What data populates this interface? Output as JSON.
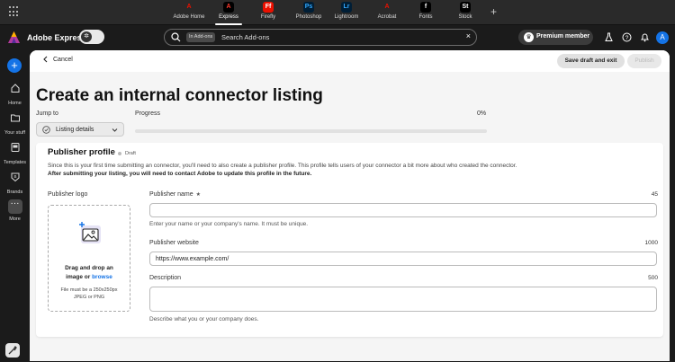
{
  "switcher": {
    "apps": [
      {
        "label": "Adobe Home",
        "glyph": "A",
        "bg": "#2a2a2a",
        "fg": "#eb1000",
        "active": false
      },
      {
        "label": "Express",
        "glyph": "A",
        "bg": "#000000",
        "fg": "#ff3a2e",
        "active": true
      },
      {
        "label": "Firefly",
        "glyph": "Ff",
        "bg": "#eb1000",
        "fg": "#ffffff",
        "active": false
      },
      {
        "label": "Photoshop",
        "glyph": "Ps",
        "bg": "#001e36",
        "fg": "#31a8ff",
        "active": false
      },
      {
        "label": "Lightroom",
        "glyph": "Lr",
        "bg": "#001e36",
        "fg": "#31a8ff",
        "active": false
      },
      {
        "label": "Acrobat",
        "glyph": "A",
        "bg": "#2a2a2a",
        "fg": "#eb1000",
        "active": false
      },
      {
        "label": "Fonts",
        "glyph": "f",
        "bg": "#000000",
        "fg": "#ffffff",
        "active": false
      },
      {
        "label": "Stock",
        "glyph": "St",
        "bg": "#000000",
        "fg": "#ffffff",
        "active": false
      }
    ]
  },
  "topbar": {
    "brand": "Adobe Express",
    "search_chip": "In Add-ons",
    "search_placeholder": "Search Add-ons",
    "premium": "Premium member",
    "avatar": "A"
  },
  "rail": {
    "items": [
      {
        "label": "Home"
      },
      {
        "label": "Your stuff"
      },
      {
        "label": "Templates"
      },
      {
        "label": "Brands"
      },
      {
        "label": "More"
      }
    ]
  },
  "header": {
    "cancel": "Cancel",
    "save_draft": "Save draft and exit",
    "publish": "Publish"
  },
  "page": {
    "title": "Create an internal connector listing",
    "jump_to": "Jump to",
    "jump_value": "Listing details",
    "progress_label": "Progress",
    "progress_value": "0%",
    "progress_fraction": 0
  },
  "profile": {
    "title": "Publisher profile",
    "status": "Draft",
    "description": "Since this is your first time submitting an connector, you'll need to also create a publisher profile. This profile tells users of your connector a bit more about who created the connector.",
    "notice": "After submitting your listing, you will need to contact Adobe to update this profile in the future.",
    "logo": {
      "label": "Publisher logo",
      "line1": "Drag and drop an",
      "line2_prefix": "image or ",
      "browse": "browse",
      "note1": "File must be a 250x250px",
      "note2": "JPEG or PNG"
    },
    "name": {
      "label": "Publisher name",
      "required": "★",
      "count": "45",
      "value": "",
      "help": "Enter your name or your company's name. It must be unique."
    },
    "website": {
      "label": "Publisher website",
      "count": "1000",
      "value": "https://www.example.com/"
    },
    "description_field": {
      "label": "Description",
      "count": "500",
      "value": "",
      "help": "Describe what you or your company does."
    }
  },
  "colors": {
    "accent": "#1473e6",
    "draft_dot": "#bbbbbb"
  }
}
